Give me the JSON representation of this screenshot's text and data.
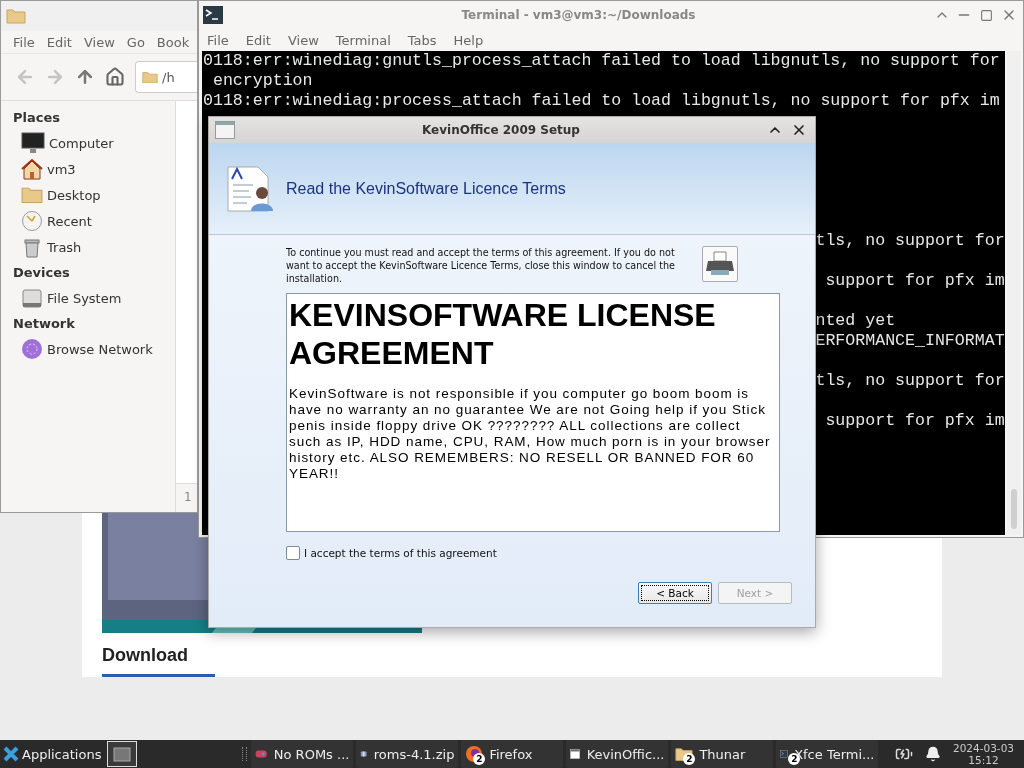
{
  "browser_page": {
    "heading": "Download"
  },
  "file_manager": {
    "menu": [
      "File",
      "Edit",
      "View",
      "Go",
      "Book"
    ],
    "location": "/h",
    "status": "1",
    "sidebar": [
      {
        "header": "Places",
        "items": [
          {
            "label": "Computer",
            "kind": "computer"
          },
          {
            "label": "vm3",
            "kind": "home"
          },
          {
            "label": "Desktop",
            "kind": "folder"
          },
          {
            "label": "Recent",
            "kind": "recent"
          },
          {
            "label": "Trash",
            "kind": "trash"
          }
        ]
      },
      {
        "header": "Devices",
        "items": [
          {
            "label": "File System",
            "kind": "drive"
          }
        ]
      },
      {
        "header": "Network",
        "items": [
          {
            "label": "Browse Network",
            "kind": "network"
          }
        ]
      }
    ]
  },
  "terminal": {
    "title": "Terminal - vm3@vm3:~/Downloads",
    "menu": [
      "File",
      "Edit",
      "View",
      "Terminal",
      "Tabs",
      "Help"
    ],
    "lines": [
      {
        "kind": "full",
        "text": "0118:err:winediag:gnutls_process_attach failed to load libgnutls, no support for"
      },
      {
        "kind": "full",
        "text": " encryption"
      },
      {
        "kind": "full",
        "text": "0118:err:winediag:process_attach failed to load libgnutls, no support for pfx im"
      },
      {
        "kind": "covered"
      },
      {
        "kind": "covered"
      },
      {
        "kind": "covered"
      },
      {
        "kind": "covered"
      },
      {
        "kind": "covered"
      },
      {
        "kind": "covered"
      },
      {
        "kind": "tail",
        "text": "tls, no support for"
      },
      {
        "kind": "covered"
      },
      {
        "kind": "tail",
        "text": " support for pfx im"
      },
      {
        "kind": "covered"
      },
      {
        "kind": "tail",
        "text": "nted yet"
      },
      {
        "kind": "tail",
        "text": "ERFORMANCE_INFORMAT"
      },
      {
        "kind": "covered"
      },
      {
        "kind": "tail",
        "text": "tls, no support for"
      },
      {
        "kind": "covered"
      },
      {
        "kind": "tail",
        "text": " support for pfx im"
      }
    ]
  },
  "dialog": {
    "title": "KevinOffice 2009 Setup",
    "heading": "Read the KevinSoftware Licence Terms",
    "intro": "To continue you must read and accept the terms of this agreement. If you do not want to accept the KevinSoftware Licence Terms, close this window to cancel the installation.",
    "license_title": "KEVINSOFTWARE LICENSE AGREEMENT",
    "license_body": "KevinSoftware is not responsible if you computer go boom boom is have no warranty an no guarantee We are not Going help if you Stick penis inside floppy drive OK ???????? ALL collections are collect such as IP, HDD name, CPU, RAM, How much porn is in your browser history etc. ALSO REMEMBERS: NO RESELL OR BANNED FOR 60 YEAR!!",
    "checkbox": {
      "label": "I accept the terms of this agreement",
      "checked": false
    },
    "buttons": [
      {
        "label": "< Back",
        "focused": true,
        "disabled": false
      },
      {
        "label": "Next >",
        "focused": false,
        "disabled": true
      }
    ]
  },
  "taskbar": {
    "menu_label": "Applications",
    "tasks": [
      {
        "label": "No ROMs ...",
        "kind": "game"
      },
      {
        "label": "roms-4.1.zip",
        "kind": "archive"
      },
      {
        "label": "Firefox",
        "kind": "browser",
        "badge": "2"
      },
      {
        "label": "KevinOffic...",
        "kind": "window"
      },
      {
        "label": "Thunar",
        "kind": "folder",
        "badge": "2"
      },
      {
        "label": "Xfce Termi...",
        "kind": "terminal",
        "badge": "2"
      }
    ],
    "date": "2024-03-03",
    "time": "15:12"
  }
}
